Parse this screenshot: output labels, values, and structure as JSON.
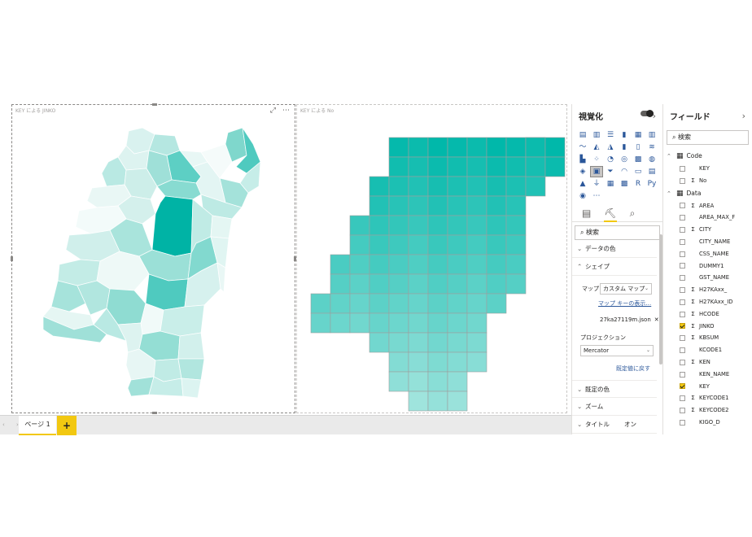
{
  "canvas": {
    "visual1": {
      "title": "KEY による JINKO",
      "focus_icon": "⤢",
      "more_icon": "⋯"
    },
    "visual2": {
      "title": "KEY による No"
    },
    "map1_color": "#01b8aa",
    "map2_color": "#01b8aa"
  },
  "pages": {
    "tab_label": "ページ 1",
    "add_label": "+",
    "nav_arrows": "‹ ›"
  },
  "visualizations": {
    "title": "視覚化",
    "collapse_icon": "›",
    "search_placeholder": "検索",
    "sections": {
      "data_colors": "データの色",
      "shape": "シェイプ",
      "default_colors": "既定の色",
      "zoom": "ズーム",
      "title": "タイトル"
    },
    "map_label": "マップ",
    "map_value": "カスタム マップ",
    "map_key_link": "マップ キーの表示…",
    "map_file": "27ka27119m.json",
    "projection_label": "プロジェクション",
    "projection_value": "Mercator",
    "reset_link": "既定値に戻す",
    "title_toggle": "オン"
  },
  "fields": {
    "title": "フィールド",
    "collapse_icon": "›",
    "search_placeholder": "検索",
    "tables": [
      {
        "name": "Code",
        "items": [
          {
            "label": "KEY",
            "sigma": false,
            "checked": false
          },
          {
            "label": "No",
            "sigma": true,
            "checked": false
          }
        ]
      },
      {
        "name": "Data",
        "items": [
          {
            "label": "AREA",
            "sigma": true,
            "checked": false
          },
          {
            "label": "AREA_MAX_F",
            "sigma": false,
            "checked": false
          },
          {
            "label": "CITY",
            "sigma": true,
            "checked": false
          },
          {
            "label": "CITY_NAME",
            "sigma": false,
            "checked": false
          },
          {
            "label": "CSS_NAME",
            "sigma": false,
            "checked": false
          },
          {
            "label": "DUMMY1",
            "sigma": false,
            "checked": false
          },
          {
            "label": "GST_NAME",
            "sigma": false,
            "checked": false
          },
          {
            "label": "H27KAxx_",
            "sigma": true,
            "checked": false
          },
          {
            "label": "H27KAxx_ID",
            "sigma": true,
            "checked": false
          },
          {
            "label": "HCODE",
            "sigma": true,
            "checked": false
          },
          {
            "label": "JINKO",
            "sigma": true,
            "checked": true
          },
          {
            "label": "KBSUM",
            "sigma": true,
            "checked": false
          },
          {
            "label": "KCODE1",
            "sigma": false,
            "checked": false
          },
          {
            "label": "KEN",
            "sigma": true,
            "checked": false
          },
          {
            "label": "KEN_NAME",
            "sigma": false,
            "checked": false
          },
          {
            "label": "KEY",
            "sigma": false,
            "checked": true
          },
          {
            "label": "KEYCODE1",
            "sigma": true,
            "checked": false
          },
          {
            "label": "KEYCODE2",
            "sigma": true,
            "checked": false
          },
          {
            "label": "KIGO_D",
            "sigma": false,
            "checked": false
          }
        ]
      }
    ]
  }
}
